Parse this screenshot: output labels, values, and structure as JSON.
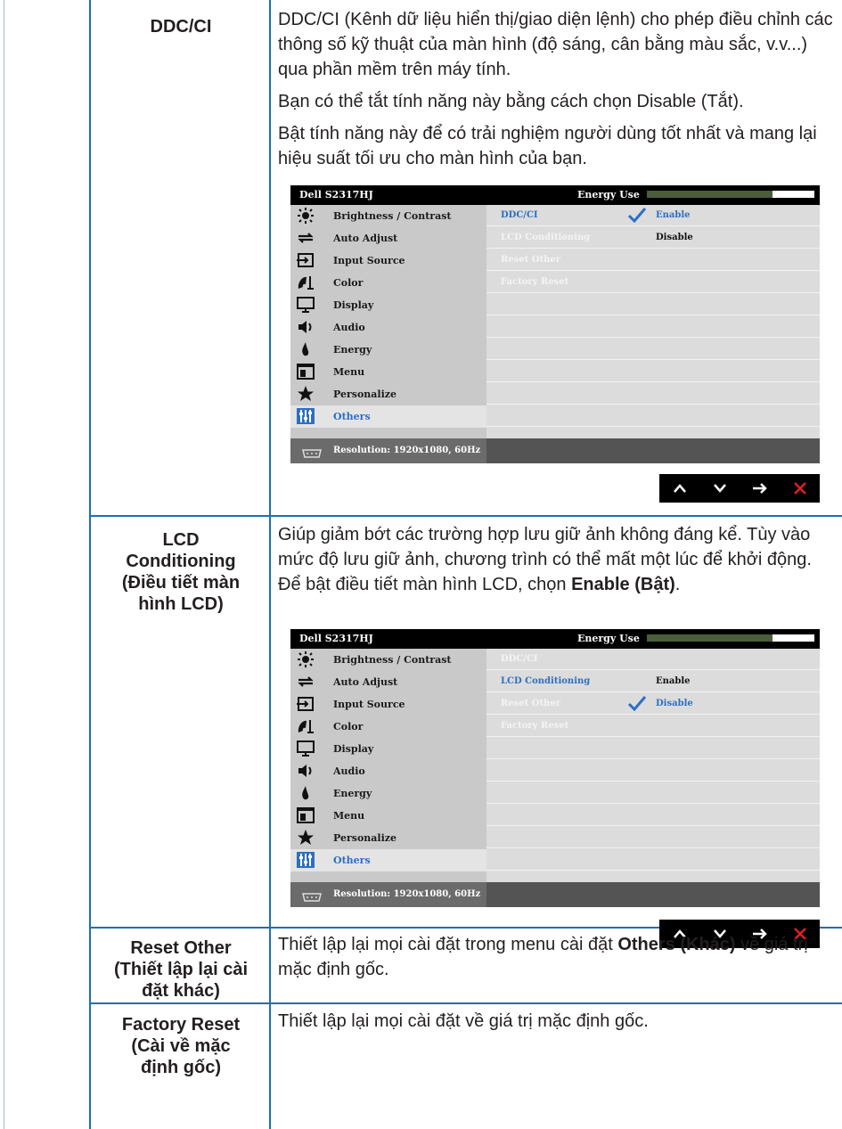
{
  "rows": [
    {
      "term": [
        "DDC/CI"
      ],
      "desc": [
        "DDC/CI (Kênh dữ liệu hiển thị/giao diện lệnh) cho phép điều chỉnh các thông số kỹ thuật của màn hình (độ sáng, cân bằng màu sắc, v.v...) qua phần mềm trên máy tính.",
        "Bạn có thể tắt tính năng này bằng cách chọn Disable (Tắt).",
        "Bật tính năng này để có trải nghiệm người dùng tốt nhất và mang lại hiệu suất tối ưu cho màn hình của bạn."
      ]
    },
    {
      "term": [
        "LCD",
        "Conditioning",
        "(Điều tiết màn",
        "hình LCD)"
      ],
      "desc_text": "Giúp giảm bớt các trường hợp lưu giữ ảnh không đáng kể. Tùy vào mức độ lưu giữ ảnh, chương trình có thể mất một lúc để khởi động. Để bật điều tiết màn hình LCD, chọn ",
      "desc_bold": "Enable (Bật)",
      "desc_tail": "."
    },
    {
      "term": [
        "Reset Other",
        "(Thiết lập lại cài",
        "đặt khác)"
      ],
      "desc_text": "Thiết lập lại mọi cài đặt trong menu cài đặt ",
      "desc_bold": "Others (Khác)",
      "desc_tail": " về giá trị mặc định gốc."
    },
    {
      "term": [
        "Factory Reset",
        "(Cài về mặc",
        "định gốc)"
      ],
      "desc_text": "Thiết lập lại mọi cài đặt về giá trị mặc định gốc."
    }
  ],
  "osd": {
    "model": "Dell S2317HJ",
    "energy_label": "Energy Use",
    "energy_level": 0.75,
    "menu": [
      "Brightness / Contrast",
      "Auto Adjust",
      "Input Source",
      "Color",
      "Display",
      "Audio",
      "Energy",
      "Menu",
      "Personalize",
      "Others"
    ],
    "selected_menu": "Others",
    "options": [
      "DDC/CI",
      "LCD Conditioning",
      "Reset Other",
      "Factory Reset"
    ],
    "values": [
      "Enable",
      "Disable"
    ],
    "resolution": "Resolution: 1920x1080, 60Hz"
  },
  "osd1": {
    "active_option": "DDC/CI",
    "checked_value": "Enable"
  },
  "osd2": {
    "active_option": "LCD Conditioning",
    "checked_value": "Disable"
  },
  "colors": {
    "rule": "#1f6fb2",
    "accent": "#2d6fc3",
    "nav_close": "#e02020"
  },
  "nav_icons": [
    "up-arrow-icon",
    "down-arrow-icon",
    "right-arrow-icon",
    "close-icon"
  ]
}
